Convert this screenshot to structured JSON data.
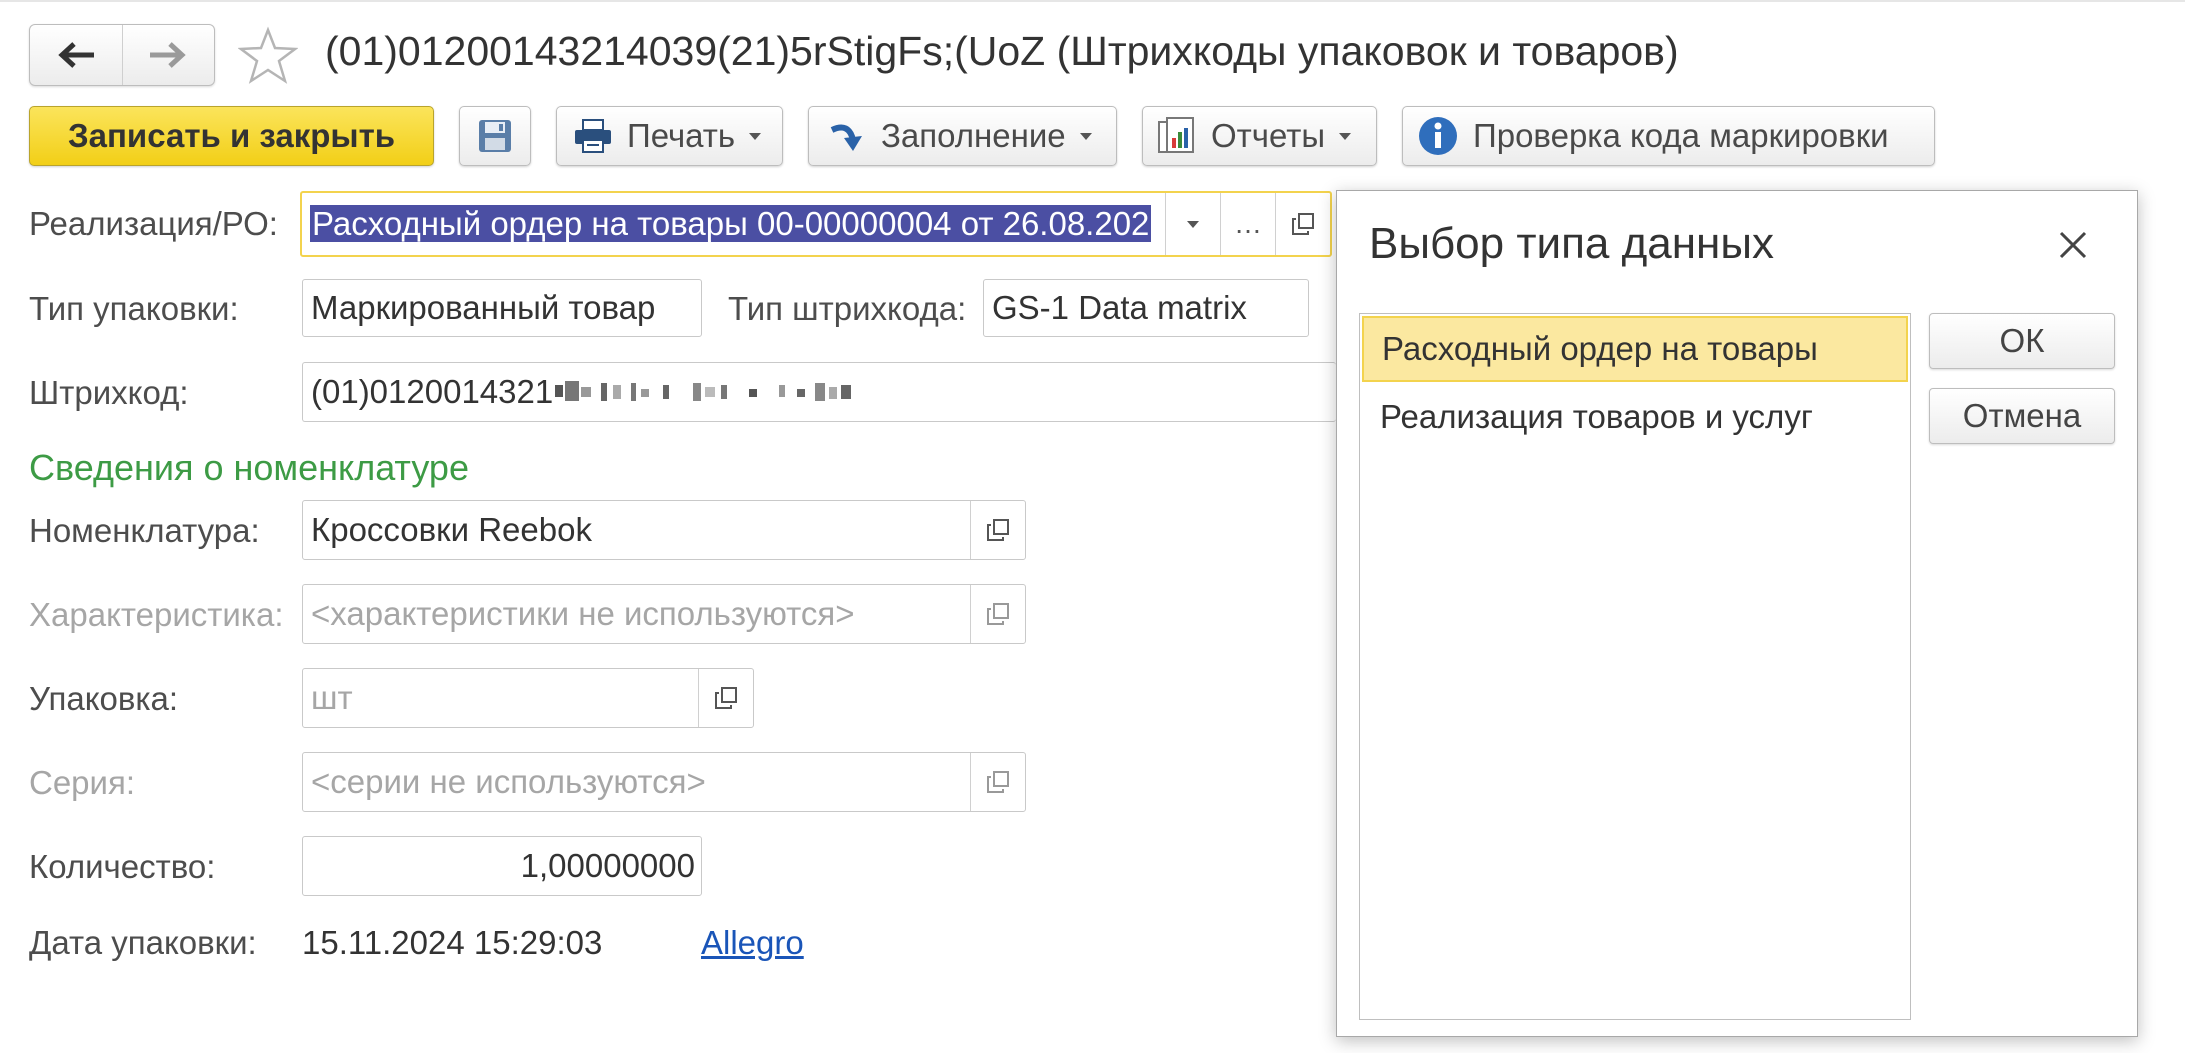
{
  "window": {
    "title": "(01)01200143214039(21)5rStigFs;(UoZ (Штрихкоды упаковок и товаров)"
  },
  "toolbar": {
    "save_close_label": "Записать и закрыть",
    "print_label": "Печать",
    "fill_label": "Заполнение",
    "reports_label": "Отчеты",
    "check_code_label": "Проверка кода маркировки"
  },
  "form": {
    "realization_label": "Реализация/РО:",
    "realization_value": "Расходный ордер на товары 00-00000004 от 26.08.202",
    "pack_type_label": "Тип упаковки:",
    "pack_type_value": "Маркированный товар",
    "barcode_type_label": "Тип штрихкода:",
    "barcode_type_value": "GS-1 Data matrix",
    "barcode_label": "Штрихкод:",
    "barcode_value": "(01)0120014321",
    "section_title": "Сведения о номенклатуре",
    "nomenclature_label": "Номенклатура:",
    "nomenclature_value": "Кроссовки Reebok",
    "characteristic_label": "Характеристика:",
    "characteristic_value": "<характеристики не используются>",
    "package_label": "Упаковка:",
    "package_value": "шт",
    "series_label": "Серия:",
    "series_value": "<серии не используются>",
    "quantity_label": "Количество:",
    "quantity_value": "1,00000000",
    "pack_date_label": "Дата упаковки:",
    "pack_date_value": "15.11.2024 15:29:03",
    "link_label": "Allegro"
  },
  "dialog": {
    "title": "Выбор типа данных",
    "items": [
      {
        "label": "Расходный ордер на товары"
      },
      {
        "label": "Реализация товаров и услуг"
      }
    ],
    "ok_label": "ОК",
    "cancel_label": "Отмена"
  },
  "colors": {
    "primary_button": "#f2cf17",
    "section_title": "#3d9b45",
    "selection": "#4b4fa3",
    "list_selected": "#fbe8a0",
    "link": "#1a55b8"
  }
}
